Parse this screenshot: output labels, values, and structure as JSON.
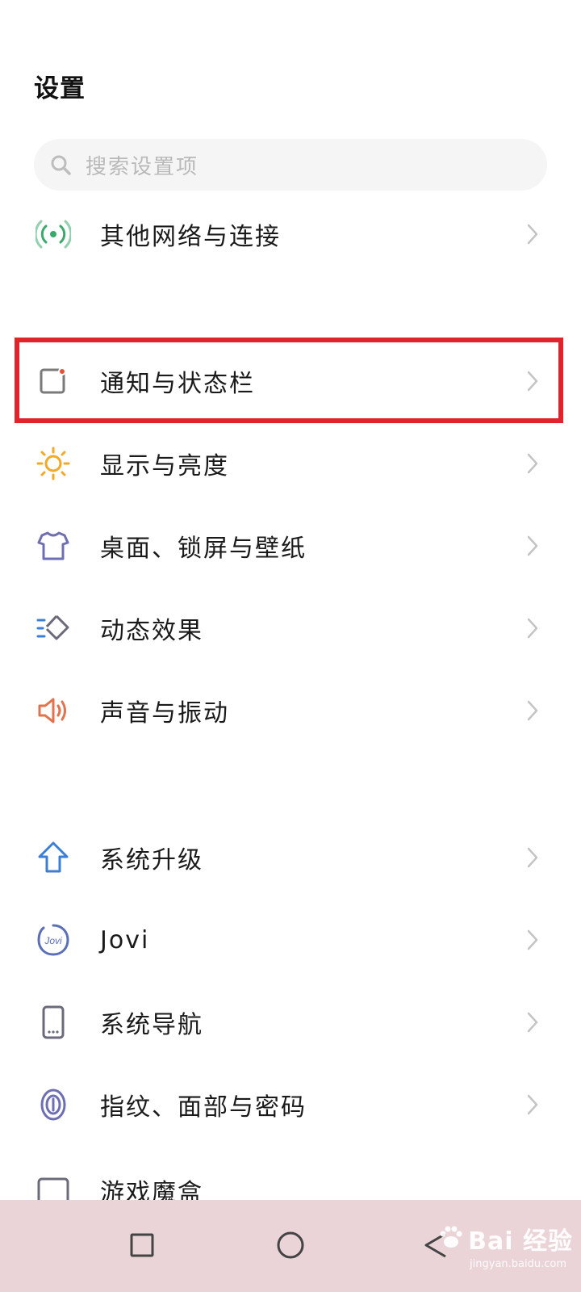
{
  "header": {
    "title": "设置"
  },
  "search": {
    "placeholder": "搜索设置项"
  },
  "items": [
    {
      "label": "其他网络与连接",
      "icon": "network-icon"
    },
    {
      "label": "通知与状态栏",
      "icon": "notification-icon",
      "highlighted": true
    },
    {
      "label": "显示与亮度",
      "icon": "brightness-icon"
    },
    {
      "label": "桌面、锁屏与壁纸",
      "icon": "wallpaper-icon"
    },
    {
      "label": "动态效果",
      "icon": "animation-icon"
    },
    {
      "label": "声音与振动",
      "icon": "sound-icon"
    },
    {
      "label": "系统升级",
      "icon": "upgrade-icon"
    },
    {
      "label": "Jovi",
      "icon": "jovi-icon"
    },
    {
      "label": "系统导航",
      "icon": "phone-icon"
    },
    {
      "label": "指纹、面部与密码",
      "icon": "fingerprint-icon"
    },
    {
      "label": "游戏魔盒",
      "icon": "game-icon"
    }
  ],
  "jovi_logo_text": "Jovi",
  "navbar": {
    "recent": "square-icon",
    "home": "circle-icon",
    "back": "back-triangle-icon"
  },
  "watermark": {
    "main": "Bai 经验",
    "sub": "jingyan.baidu.com"
  },
  "colors": {
    "highlight": "#e1232c",
    "navbar_bg": "#ead4d8"
  }
}
